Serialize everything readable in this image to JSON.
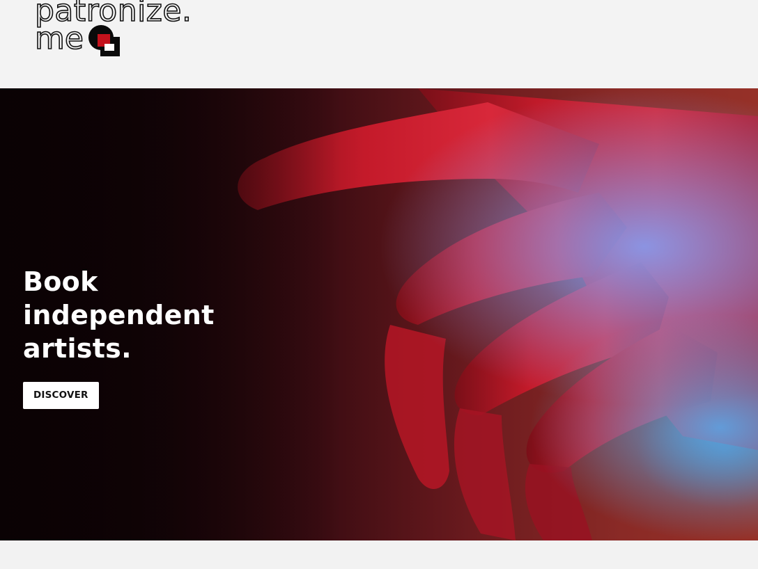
{
  "header": {
    "logo": {
      "line1": "patronize.",
      "line2": "me",
      "mark_colors": {
        "red": "#c4121c",
        "black": "#0a0a0a"
      }
    }
  },
  "hero": {
    "title": "Book independent artists.",
    "cta_label": "DISCOVER",
    "image_icon": "hand-photo",
    "colors": {
      "dark": "#0f0306",
      "red": "#c4121c",
      "blue_light": "#5a82d2"
    }
  }
}
